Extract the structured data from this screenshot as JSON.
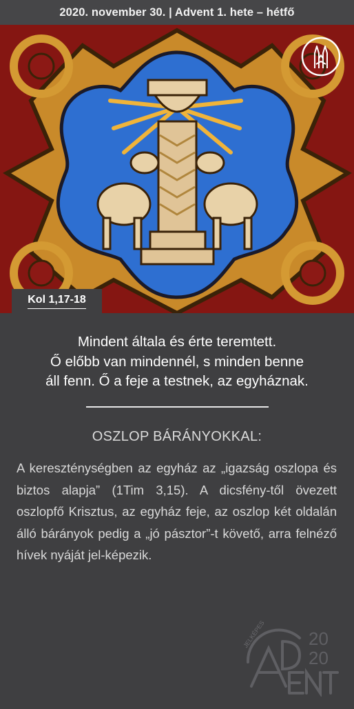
{
  "header": {
    "date_line": "2020. november 30. | Advent 1. hete – hétfő"
  },
  "image": {
    "icon": "church-candle-logo-icon"
  },
  "reference": {
    "label": "Kol 1,17-18"
  },
  "quote": {
    "line1": "Mindent általa és érte teremtett.",
    "line2": "Ő előbb van mindennél, s minden benne",
    "line3": "áll fenn. Ő a feje a testnek, az egyháznak."
  },
  "section": {
    "title": "OSZLOP BÁRÁNYOKKAL:",
    "body": "A kereszténységben az egyház az „igazság oszlopa és biztos alapja” (1Tim 3,15). A dicsfény-től övezett oszlopfő Krisztus, az egyház feje, az oszlop két oldalán álló bárányok pedig a „jó pásztor”-t követő, arra felnéző hívek nyáját jel-képezik."
  },
  "footer_logo": {
    "word": "JELKÉPES",
    "year_top": "20",
    "year_bottom": "20",
    "letters": "ADVENT"
  },
  "colors": {
    "background": "#3f3f41",
    "header": "#464648",
    "image_red": "#8f1a16",
    "image_blue": "#2f6fd0",
    "image_gold": "#d9a23a"
  }
}
